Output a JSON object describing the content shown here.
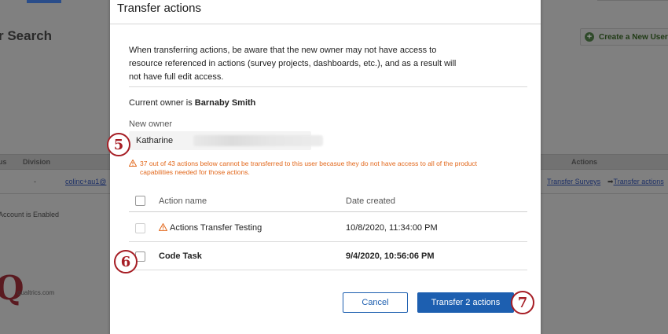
{
  "background": {
    "page_title": "r Search",
    "create_button": "Create a New User",
    "table_headers": {
      "status": "us",
      "division": "Division",
      "actions": "Actions"
    },
    "row": {
      "division": "-",
      "email": "colinc+au1@",
      "transfer_surveys": "Transfer Surveys",
      "transfer_actions": "Transfer actions"
    },
    "account_status": "Account is Enabled",
    "logo_text": "qualtrics.com"
  },
  "modal": {
    "title": "Transfer actions",
    "warning": "When transferring actions, be aware that the new owner may not have access to resource referenced in actions (survey projects, dashboards, etc.), and as a result will not have full edit access.",
    "current_owner_prefix": "Current owner is ",
    "current_owner_name": "Barnaby Smith",
    "new_owner_label": "New owner",
    "new_owner_value": "Katharine",
    "alert": "37 out of 43 actions below cannot be transferred to this user becasue they do not have access to all of the product capabilities needed for those actions.",
    "table": {
      "headers": {
        "name": "Action name",
        "date": "Date created"
      },
      "rows": [
        {
          "name": "Actions Transfer Testing",
          "date": "10/8/2020, 11:34:00 PM",
          "warning": true,
          "disabled": true
        },
        {
          "name": "Code Task",
          "date": "9/4/2020, 10:56:06 PM",
          "warning": false,
          "disabled": false
        }
      ]
    },
    "cancel_label": "Cancel",
    "transfer_label": "Transfer 2 actions"
  },
  "callouts": [
    "5",
    "6",
    "7"
  ],
  "colors": {
    "accent": "#1d5fb0",
    "warning": "#e2681c",
    "callout": "#a61d24"
  }
}
